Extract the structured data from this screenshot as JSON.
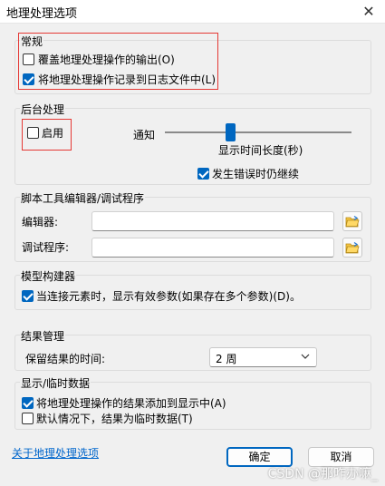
{
  "window": {
    "title": "地理处理选项",
    "close_glyph": "✕"
  },
  "general": {
    "label": "常规",
    "overwrite_output": {
      "label": "覆盖地理处理操作的输出(O)",
      "checked": false
    },
    "log_operations": {
      "label": "将地理处理操作记录到日志文件中(L)",
      "checked": true
    }
  },
  "background": {
    "label": "后台处理",
    "enable": {
      "label": "启用",
      "checked": false
    },
    "notify_label": "通知",
    "slider_caption": "显示时间长度(秒)",
    "continue_on_error": {
      "label": "发生错误时仍继续",
      "checked": true
    }
  },
  "script_tool": {
    "label": "脚本工具编辑器/调试程序",
    "editor_label": "编辑器:",
    "editor_value": "",
    "debugger_label": "调试程序:",
    "debugger_value": ""
  },
  "model_builder": {
    "label": "模型构建器",
    "show_valid_params": {
      "label": "当连接元素时，显示有效参数(如果存在多个参数)(D)。",
      "checked": true
    }
  },
  "results": {
    "label": "结果管理",
    "keep_label": "保留结果的时间:",
    "keep_value": "2 周"
  },
  "display_temp": {
    "label": "显示/临时数据",
    "add_to_display": {
      "label": "将地理处理操作的结果添加到显示中(A)",
      "checked": true
    },
    "temp_by_default": {
      "label": "默认情况下，结果为临时数据(T)",
      "checked": false
    }
  },
  "footer": {
    "about_link": "关于地理处理选项",
    "ok_label": "确定",
    "cancel_label": "取消"
  },
  "watermark": "CSDN @那咋办嘛_",
  "colors": {
    "accent": "#0067c0",
    "highlight_box": "#e53935",
    "link": "#0066cc"
  }
}
